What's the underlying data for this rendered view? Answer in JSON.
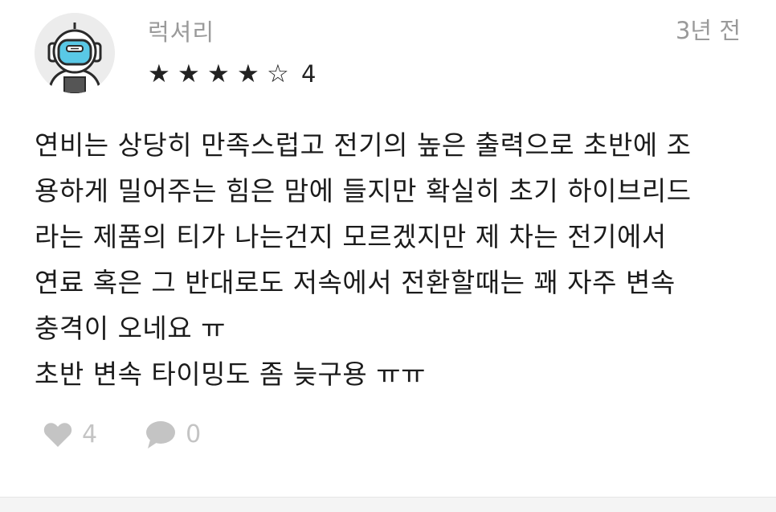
{
  "review": {
    "username": "럭셔리",
    "timestamp": "3년 전",
    "rating": {
      "stars": [
        "★",
        "★",
        "★",
        "★",
        "☆"
      ],
      "value": "4"
    },
    "body_lines": [
      "연비는 상당히 만족스럽고 전기의 높은 출력으로 초반에 조",
      "용하게 밀어주는 힘은 맘에 들지만 확실히 초기 하이브리드",
      "라는 제품의 티가 나는건지 모르겠지만 제 차는 전기에서",
      "연료 혹은 그 반대로도 저속에서 전환할때는 꽤 자주 변속",
      "충격이 오네요 ㅠ",
      "초반 변속 타이밍도 좀 늦구용 ㅠㅠ"
    ],
    "actions": {
      "likes": "4",
      "comments": "0"
    },
    "icons": {
      "avatar": "astronaut-avatar-icon",
      "like": "heart-icon",
      "comment": "speech-bubble-icon"
    },
    "colors": {
      "text": "#1b1b1b",
      "muted": "#9a9a9a",
      "action": "#c4c4c4",
      "visor": "#59c8e6"
    }
  }
}
